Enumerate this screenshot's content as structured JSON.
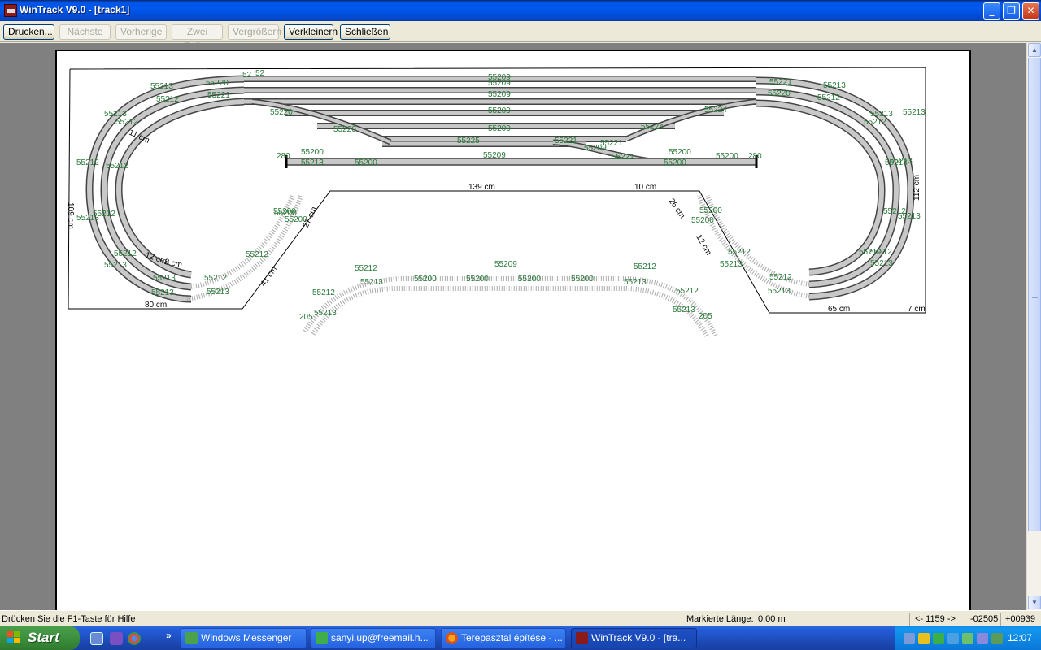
{
  "window": {
    "title": "WinTrack  V9.0 - [track1]",
    "minimize": "_",
    "restore": "❐",
    "close": "✕"
  },
  "toolbar": {
    "print": "Drucken...",
    "next": "Nächste",
    "previous": "Vorherige",
    "two_pages": "Zwei Seiten",
    "zoom_in": "Vergrößern",
    "zoom_out": "Verkleinern",
    "close": "Schließen"
  },
  "plan": {
    "part_labels": [
      "55213",
      "55220",
      "52",
      "52",
      "55221",
      "55213",
      "55212",
      "55221",
      "55220",
      "55213",
      "55212",
      "55220",
      "55209",
      "55209",
      "55209",
      "55209",
      "55220",
      "55224",
      "55224",
      "55212",
      "55213",
      "55221",
      "55225",
      "55221",
      "55209",
      "55221",
      "55209",
      "55213",
      "55212",
      "55212",
      "55213",
      "55213",
      "55212",
      "55213",
      "55212",
      "55213",
      "55200",
      "55200",
      "55212",
      "55213",
      "55212",
      "55213",
      "55212",
      "55213",
      "55200",
      "55200",
      "55212",
      "55213",
      "55212",
      "55213",
      "55212",
      "55213",
      "55209",
      "55200",
      "55200",
      "55200",
      "55200",
      "55212",
      "55213",
      "55212",
      "55213",
      "205",
      "205",
      "280",
      "280",
      "55200",
      "55200",
      "55200",
      "55200",
      "55209",
      "55212",
      "55213",
      "55200",
      "55200",
      "55213",
      "55212",
      "55212",
      "55213",
      "55213",
      "55212"
    ],
    "dimensions": [
      "109 cm",
      "139 cm",
      "10 cm",
      "112 cm",
      "80 cm",
      "65 cm",
      "7 cm",
      "27 cm",
      "41 cm",
      "26 cm",
      "12 cm",
      "11 cm",
      "12 cm",
      "8 cm"
    ]
  },
  "statusbar": {
    "help": "Drücken Sie die  F1-Taste für Hilfe",
    "marked_length_label": "Markierte Länge:",
    "marked_length_value": "0.00 m",
    "nav": "<- 1159 ->",
    "coord_x": "-02505",
    "coord_y": "+00939"
  },
  "taskbar": {
    "start": "Start",
    "chevron": "»",
    "tasks": [
      "Windows Messenger",
      "sanyi.up@freemail.h...",
      "Terepasztal építése - ...",
      "WinTrack  V9.0 - [tra..."
    ],
    "clock": "12:07"
  },
  "colors": {
    "track_fill": "#c8c8c8",
    "track_edge": "#555555",
    "label_green": "#2a7a3a",
    "titlebar_blue": "#0054e3",
    "taskbar_blue": "#245edb"
  }
}
